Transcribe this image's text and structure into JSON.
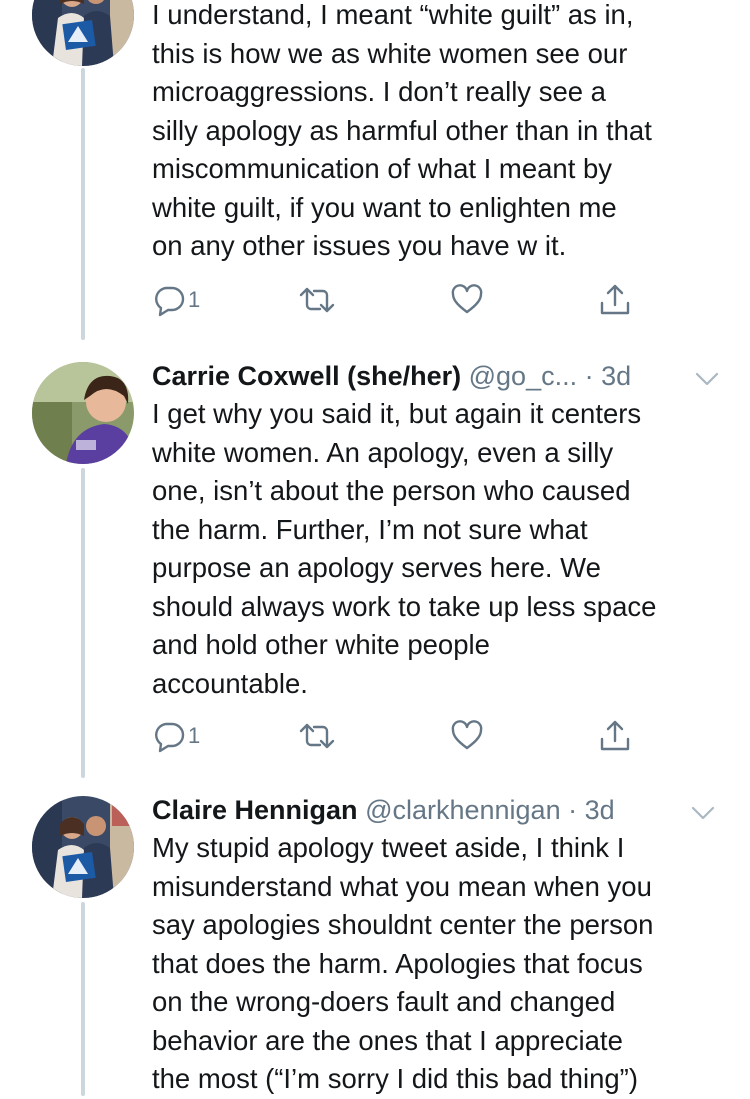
{
  "tweets": [
    {
      "name": "",
      "handle": "",
      "time": "",
      "text": "I understand, I meant “white guilt” as in,\nthis is how we as white women see our\nmicroaggressions. I don’t really see a\nsilly apology as harmful other than in that\nmiscommunication of what I meant by\nwhite guilt, if you want to enlighten me\non any other issues you have w it.",
      "reply_count": "1"
    },
    {
      "name": "Carrie Coxwell (she/her)",
      "handle": "@go_c...",
      "time": "· 3d",
      "text": "I get why you said it, but again it centers\nwhite women. An apology, even a silly\none, isn’t about the person who caused\nthe harm. Further, I’m not sure what\npurpose an apology serves here. We\nshould always work to take up less space\nand hold other white people\naccountable.",
      "reply_count": "1"
    },
    {
      "name": "Claire Hennigan",
      "handle": "@clarkhennigan",
      "time": "· 3d",
      "text": "My stupid apology tweet aside, I think I\nmisunderstand what you mean when you\nsay apologies shouldnt center the person\nthat does the harm. Apologies that focus\non the wrong-doers fault and changed\nbehavior are the ones that I appreciate\nthe most (“I’m sorry I did this bad thing”)"
    }
  ],
  "colors": {
    "text": "#14171a",
    "secondary": "#657786",
    "thread_line": "#ccd6dd"
  },
  "icons": {
    "reply": "speech-bubble-icon",
    "retweet": "retweet-icon",
    "like": "heart-icon",
    "share": "share-icon",
    "menu": "chevron-down-icon"
  }
}
